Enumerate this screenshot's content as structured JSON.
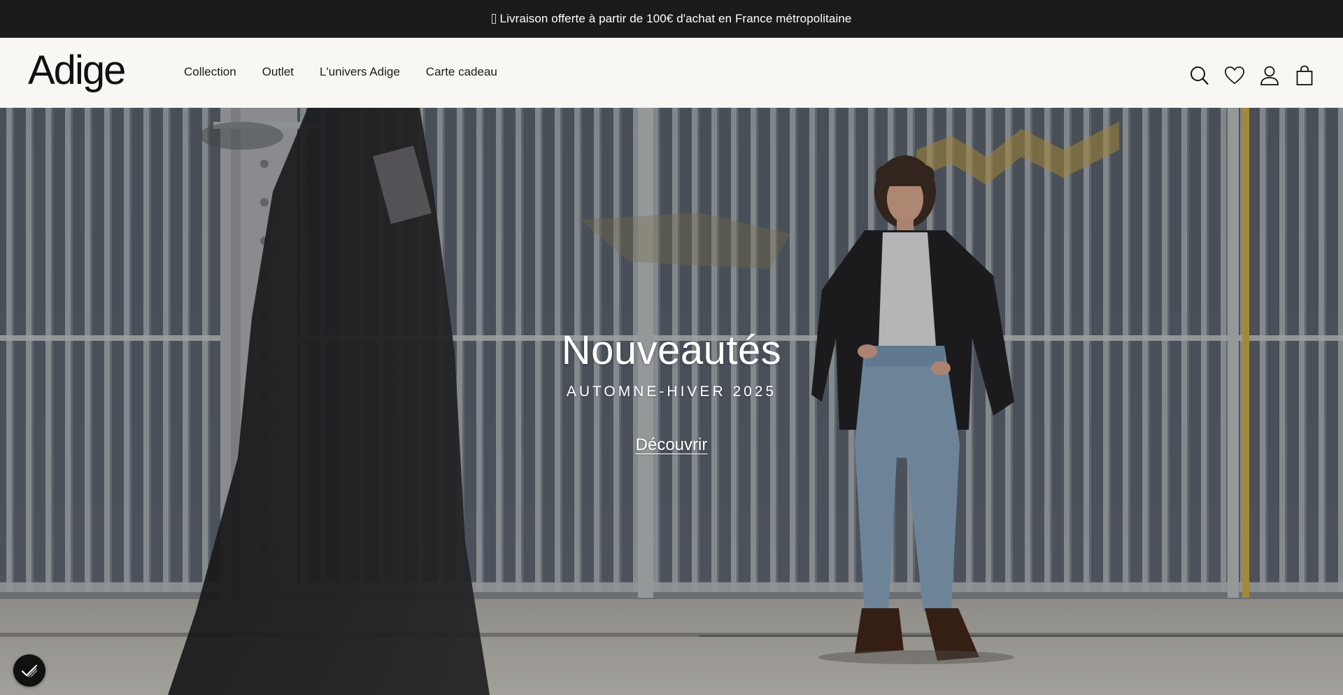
{
  "announcement": {
    "icon": "truck-icon",
    "text": "Livraison offerte à partir de 100€ d'achat en France métropolitaine"
  },
  "header": {
    "logo_text": "Adige",
    "nav": [
      {
        "label": "Collection"
      },
      {
        "label": "Outlet"
      },
      {
        "label": "L'univers Adige"
      },
      {
        "label": "Carte cadeau"
      }
    ],
    "icons": [
      "search-icon",
      "heart-icon",
      "account-icon",
      "bag-icon"
    ]
  },
  "hero": {
    "title": "Nouveautés",
    "subtitle": "AUTOMNE-HIVER 2025",
    "cta": "Découvrir"
  },
  "cookie_button": {
    "icon": "cookie-consent-icon"
  },
  "colors": {
    "announce_bg": "#1b1b1b",
    "header_bg": "#f8f7f3",
    "text": "#1b1b1b",
    "hero_text": "#ffffff"
  }
}
